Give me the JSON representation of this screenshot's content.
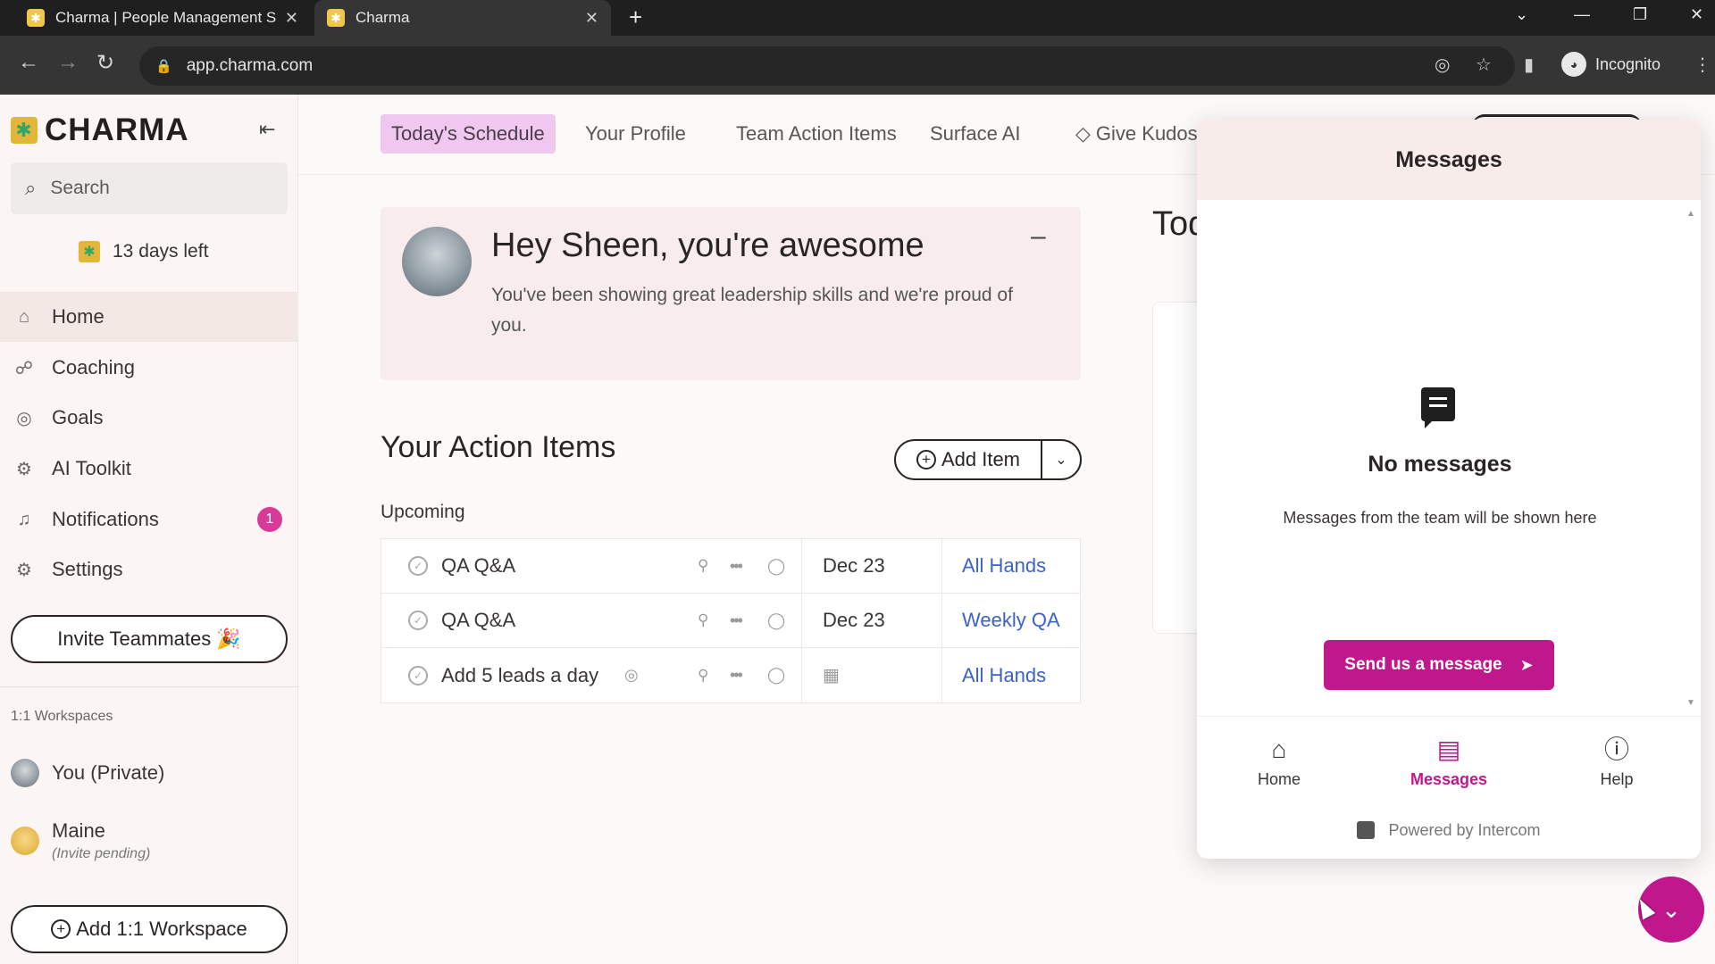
{
  "browser": {
    "tabs": [
      {
        "title": "Charma | People Management S",
        "close": "✕"
      },
      {
        "title": "Charma",
        "close": "✕"
      }
    ],
    "new_tab": "+",
    "url": "app.charma.com",
    "profile_label": "Incognito"
  },
  "sidebar": {
    "logo": "CHARMA",
    "search_placeholder": "Search",
    "trial_text": "13 days left",
    "nav": [
      {
        "label": "Home",
        "icon": "home-icon"
      },
      {
        "label": "Coaching",
        "icon": "coaching-icon"
      },
      {
        "label": "Goals",
        "icon": "goals-icon"
      },
      {
        "label": "AI Toolkit",
        "icon": "robot-icon"
      },
      {
        "label": "Notifications",
        "icon": "bell-icon",
        "badge": "1"
      },
      {
        "label": "Settings",
        "icon": "gear-icon"
      }
    ],
    "invite_button": "Invite Teammates 🎉",
    "workspaces_title": "1:1 Workspaces",
    "workspaces": [
      {
        "name": "You (Private)"
      },
      {
        "name": "Maine",
        "sub": "(Invite pending)"
      }
    ],
    "add_workspace_button": "Add 1:1 Workspace"
  },
  "topnav": {
    "items": [
      "Today's Schedule",
      "Your Profile",
      "Team Action Items",
      "Surface AI",
      "Give Kudos"
    ],
    "active": "Today's Schedule"
  },
  "kudos": {
    "title": "Hey Sheen, you're awesome",
    "text": "You've been showing great leadership skills and we're proud of you.",
    "minimize": "–"
  },
  "action_items": {
    "title": "Your Action Items",
    "add_label": "Add Item",
    "group_label": "Upcoming",
    "rows": [
      {
        "name": "QA Q&A",
        "date": "Dec 23",
        "meeting": "All Hands",
        "has_goal": false
      },
      {
        "name": "QA Q&A",
        "date": "Dec 23",
        "meeting": "Weekly QA",
        "has_goal": false
      },
      {
        "name": "Add 5 leads a day",
        "date": "",
        "meeting": "All Hands",
        "has_goal": true
      }
    ]
  },
  "today_partial": "Tod",
  "messenger": {
    "title": "Messages",
    "empty_title": "No messages",
    "empty_text": "Messages from the team will be shown here",
    "send_button": "Send us a message",
    "tabs": [
      {
        "label": "Home",
        "icon": "home-icon"
      },
      {
        "label": "Messages",
        "icon": "messages-icon"
      },
      {
        "label": "Help",
        "icon": "help-icon"
      }
    ],
    "active_tab": "Messages",
    "powered_by": "Powered by Intercom"
  },
  "colors": {
    "accent": "#c0178d",
    "active_tab_bg": "#f0c7ee",
    "link": "#3b63c7",
    "badge": "#d93a9a"
  }
}
